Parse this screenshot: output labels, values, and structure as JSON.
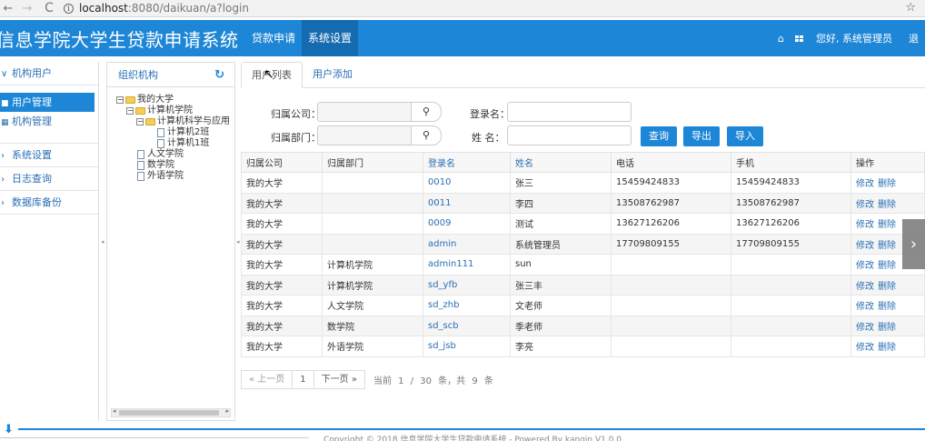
{
  "browser": {
    "back": "←",
    "forward": "→",
    "reload": "C",
    "url_host": "localhost",
    "url_path": ":8080/daikuan/a?login",
    "star": "☆",
    "info": "i"
  },
  "header": {
    "app_title": "信息学院大学生贷款申请系统",
    "nav": [
      "贷款申请",
      "系统设置"
    ],
    "active_nav": "系统设置",
    "home_icon": "⌂",
    "greeting": "您好, 系统管理员",
    "logout": "退"
  },
  "sidebar": {
    "group_org": "机构用户",
    "items": [
      "用户管理",
      "机构管理"
    ],
    "groups": [
      "系统设置",
      "日志查询",
      "数据库备份"
    ],
    "arrow_open": "∨",
    "arrow_closed": "›",
    "handle": "◂"
  },
  "org_panel": {
    "title": "组织机构",
    "refresh": "↻",
    "tree": [
      {
        "label": "我的大学",
        "level": 0,
        "type": "folder",
        "toggle": "⊟"
      },
      {
        "label": "计算机学院",
        "level": 1,
        "type": "folder",
        "toggle": "⊟"
      },
      {
        "label": "计算机科学与应用",
        "level": 2,
        "type": "folder",
        "toggle": "⊟"
      },
      {
        "label": "计算机2班",
        "level": 3,
        "type": "doc"
      },
      {
        "label": "计算机1班",
        "level": 3,
        "type": "doc"
      },
      {
        "label": "人文学院",
        "level": 1,
        "type": "doc"
      },
      {
        "label": "数学院",
        "level": 1,
        "type": "doc"
      },
      {
        "label": "外语学院",
        "level": 1,
        "type": "doc"
      }
    ],
    "scroll_left": "◂",
    "scroll_right": "▸"
  },
  "main": {
    "tabs": [
      "用户列表",
      "用户添加"
    ],
    "cursor": "↖",
    "form": {
      "company_label": "归属公司：",
      "dept_label": "归属部门：",
      "login_label": "登录名：",
      "name_label": "姓    名：",
      "search_icon": "🔍",
      "query": "查询",
      "export": "导出",
      "import": "导入"
    },
    "table": {
      "headers": [
        "归属公司",
        "归属部门",
        "登录名",
        "姓名",
        "电话",
        "手机",
        "操作"
      ],
      "rows": [
        [
          "我的大学",
          "",
          "0010",
          "张三",
          "15459424833",
          "15459424833"
        ],
        [
          "我的大学",
          "",
          "0011",
          "李四",
          "13508762987",
          "13508762987"
        ],
        [
          "我的大学",
          "",
          "0009",
          "测试",
          "13627126206",
          "13627126206"
        ],
        [
          "我的大学",
          "",
          "admin",
          "系统管理员",
          "17709809155",
          "17709809155"
        ],
        [
          "我的大学",
          "计算机学院",
          "admin111",
          "sun",
          "",
          ""
        ],
        [
          "我的大学",
          "计算机学院",
          "sd_yfb",
          "张三丰",
          "",
          ""
        ],
        [
          "我的大学",
          "人文学院",
          "sd_zhb",
          "文老师",
          "",
          ""
        ],
        [
          "我的大学",
          "数学院",
          "sd_scb",
          "季老师",
          "",
          ""
        ],
        [
          "我的大学",
          "外语学院",
          "sd_jsb",
          "李亮",
          "",
          ""
        ]
      ],
      "edit": "修改",
      "delete": "删除"
    },
    "pager": {
      "prev": "« 上一页",
      "page": "1",
      "next": "下一页 »",
      "info": "当前 1 / 30 条，共 9 条"
    }
  },
  "overlay": {
    "next_arrow": "›"
  },
  "footer": {
    "text": "Copyright © 2018 信息学院大学生贷款申请系统 - Powered By kanqin V1.0.0",
    "download_arrow": "⬇"
  }
}
